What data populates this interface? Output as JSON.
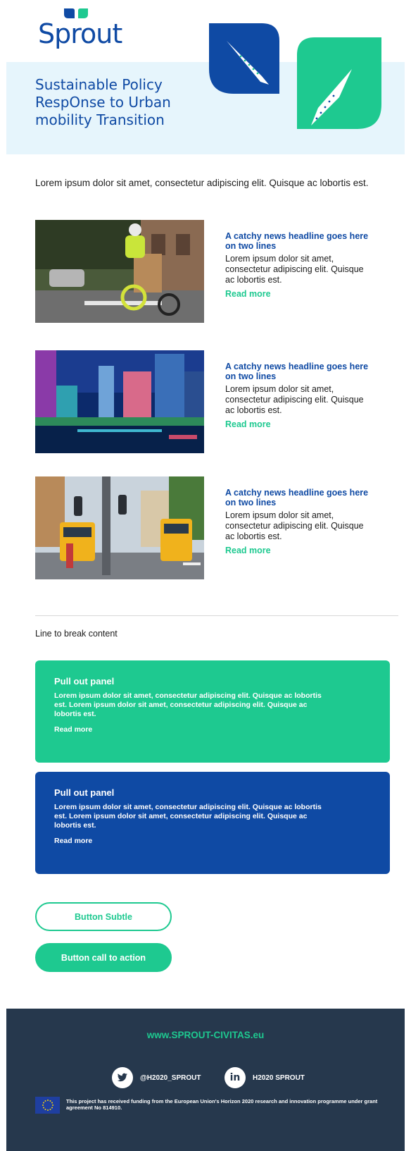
{
  "brand": {
    "logo_text": "Sprout",
    "primary_color": "#0f4aa4",
    "accent_color": "#1ec990",
    "hero_bg": "#e6f5fc",
    "footer_bg": "#26384d"
  },
  "hero": {
    "title": "Sustainable Policy RespOnse to Urban mobility Transition"
  },
  "intro": "Lorem ipsum dolor sit amet, consectetur adipiscing elit. Quisque ac lobortis est.",
  "news": [
    {
      "headline": "A catchy news headline goes here on two lines",
      "text": "Lorem ipsum dolor sit amet, consectetur adipiscing elit. Quisque ac lobortis est.",
      "link": "Read more"
    },
    {
      "headline": "A catchy news headline goes here on two lines",
      "text": "Lorem ipsum dolor sit amet, consectetur adipiscing elit. Quisque ac lobortis est.",
      "link": "Read more"
    },
    {
      "headline": "A catchy news headline goes here on two lines",
      "text": "Lorem ipsum dolor sit amet, consectetur adipiscing elit. Quisque ac lobortis est.",
      "link": "Read more"
    }
  ],
  "break_text": "Line to break content",
  "panels": [
    {
      "title": "Pull out panel",
      "text": "Lorem ipsum dolor sit amet, consectetur adipiscing elit. Quisque ac lobortis est. Lorem ipsum dolor sit amet, consectetur adipiscing elit. Quisque ac lobortis est.",
      "link": "Read more"
    },
    {
      "title": "Pull out panel",
      "text": "Lorem ipsum dolor sit amet, consectetur adipiscing elit. Quisque ac lobortis est. Lorem ipsum dolor sit amet, consectetur adipiscing elit. Quisque ac lobortis est.",
      "link": "Read more"
    }
  ],
  "buttons": {
    "subtle": "Button Subtle",
    "cta": "Button call to action"
  },
  "footer": {
    "url": "www.SPROUT-CIVITAS.eu",
    "twitter": "@H2020_SPROUT",
    "linkedin": "H2020 SPROUT",
    "funding": "This project has received funding from the European Union's Horizon 2020 research and innovation programme under grant agreement No 814910."
  }
}
